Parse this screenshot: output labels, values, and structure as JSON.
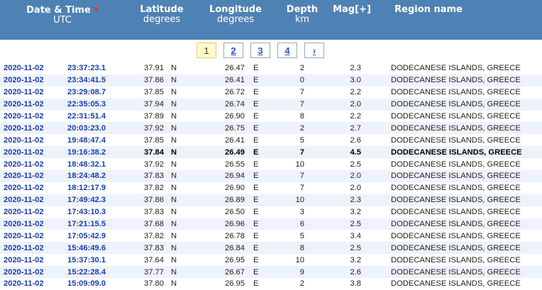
{
  "header": {
    "datetime_title": "Date & Time",
    "datetime_sub": "UTC",
    "sort_icon": "▼",
    "latitude_title": "Latitude",
    "latitude_sub": "degrees",
    "longitude_title": "Longitude",
    "longitude_sub": "degrees",
    "depth_title": "Depth",
    "depth_sub": "km",
    "mag_title": "Mag[+]",
    "region_title": "Region name"
  },
  "pager": {
    "pages": [
      "1",
      "2",
      "3",
      "4"
    ],
    "next": "›"
  },
  "colors": {
    "header_bg": "#4f82b4",
    "link": "#1a3fa8",
    "row_alt": "#eef2fb",
    "current_page": "#fffac8",
    "sort_arrow": "#e8343a"
  },
  "rows": [
    {
      "date": "2020-11-02",
      "time": "23:37:23.1",
      "lat": "37.91",
      "ns": "N",
      "lon": "26.47",
      "ew": "E",
      "depth": "2",
      "mag": "2.3",
      "region": "DODECANESE ISLANDS, GREECE"
    },
    {
      "date": "2020-11-02",
      "time": "23:34:41.5",
      "lat": "37.86",
      "ns": "N",
      "lon": "26.41",
      "ew": "E",
      "depth": "0",
      "mag": "3.0",
      "region": "DODECANESE ISLANDS, GREECE"
    },
    {
      "date": "2020-11-02",
      "time": "23:29:08.7",
      "lat": "37.85",
      "ns": "N",
      "lon": "26.72",
      "ew": "E",
      "depth": "7",
      "mag": "2.2",
      "region": "DODECANESE ISLANDS, GREECE"
    },
    {
      "date": "2020-11-02",
      "time": "22:35:05.3",
      "lat": "37.94",
      "ns": "N",
      "lon": "26.74",
      "ew": "E",
      "depth": "7",
      "mag": "2.0",
      "region": "DODECANESE ISLANDS, GREECE"
    },
    {
      "date": "2020-11-02",
      "time": "22:31:51.4",
      "lat": "37.89",
      "ns": "N",
      "lon": "26.90",
      "ew": "E",
      "depth": "8",
      "mag": "2.2",
      "region": "DODECANESE ISLANDS, GREECE"
    },
    {
      "date": "2020-11-02",
      "time": "20:03:23.0",
      "lat": "37.92",
      "ns": "N",
      "lon": "26.75",
      "ew": "E",
      "depth": "2",
      "mag": "2.7",
      "region": "DODECANESE ISLANDS, GREECE"
    },
    {
      "date": "2020-11-02",
      "time": "19:48:47.4",
      "lat": "37.85",
      "ns": "N",
      "lon": "26.41",
      "ew": "E",
      "depth": "5",
      "mag": "2.6",
      "region": "DODECANESE ISLANDS, GREECE"
    },
    {
      "date": "2020-11-02",
      "time": "19:16:38.2",
      "lat": "37.84",
      "ns": "N",
      "lon": "26.49",
      "ew": "E",
      "depth": "7",
      "mag": "4.5",
      "region": "DODECANESE ISLANDS, GREECE"
    },
    {
      "date": "2020-11-02",
      "time": "18:48:32.1",
      "lat": "37.92",
      "ns": "N",
      "lon": "26.55",
      "ew": "E",
      "depth": "10",
      "mag": "2.5",
      "region": "DODECANESE ISLANDS, GREECE"
    },
    {
      "date": "2020-11-02",
      "time": "18:24:48.2",
      "lat": "37.83",
      "ns": "N",
      "lon": "26.94",
      "ew": "E",
      "depth": "7",
      "mag": "2.0",
      "region": "DODECANESE ISLANDS, GREECE"
    },
    {
      "date": "2020-11-02",
      "time": "18:12:17.9",
      "lat": "37.82",
      "ns": "N",
      "lon": "26.90",
      "ew": "E",
      "depth": "7",
      "mag": "2.0",
      "region": "DODECANESE ISLANDS, GREECE"
    },
    {
      "date": "2020-11-02",
      "time": "17:49:42.3",
      "lat": "37.86",
      "ns": "N",
      "lon": "26.89",
      "ew": "E",
      "depth": "10",
      "mag": "2.3",
      "region": "DODECANESE ISLANDS, GREECE"
    },
    {
      "date": "2020-11-02",
      "time": "17:43:10.3",
      "lat": "37.83",
      "ns": "N",
      "lon": "26.50",
      "ew": "E",
      "depth": "3",
      "mag": "3.2",
      "region": "DODECANESE ISLANDS, GREECE"
    },
    {
      "date": "2020-11-02",
      "time": "17:21:15.5",
      "lat": "37.68",
      "ns": "N",
      "lon": "26.96",
      "ew": "E",
      "depth": "6",
      "mag": "2.5",
      "region": "DODECANESE ISLANDS, GREECE"
    },
    {
      "date": "2020-11-02",
      "time": "17:05:42.9",
      "lat": "37.82",
      "ns": "N",
      "lon": "26.78",
      "ew": "E",
      "depth": "5",
      "mag": "3.4",
      "region": "DODECANESE ISLANDS, GREECE"
    },
    {
      "date": "2020-11-02",
      "time": "15:46:49.6",
      "lat": "37.83",
      "ns": "N",
      "lon": "26.84",
      "ew": "E",
      "depth": "8",
      "mag": "2.5",
      "region": "DODECANESE ISLANDS, GREECE"
    },
    {
      "date": "2020-11-02",
      "time": "15:37:30.1",
      "lat": "37.64",
      "ns": "N",
      "lon": "26.95",
      "ew": "E",
      "depth": "10",
      "mag": "3.2",
      "region": "DODECANESE ISLANDS, GREECE"
    },
    {
      "date": "2020-11-02",
      "time": "15:22:28.4",
      "lat": "37.77",
      "ns": "N",
      "lon": "26.67",
      "ew": "E",
      "depth": "9",
      "mag": "2.6",
      "region": "DODECANESE ISLANDS, GREECE"
    },
    {
      "date": "2020-11-02",
      "time": "15:09:09.0",
      "lat": "37.80",
      "ns": "N",
      "lon": "26.95",
      "ew": "E",
      "depth": "2",
      "mag": "3.8",
      "region": "DODECANESE ISLANDS, GREECE"
    }
  ]
}
